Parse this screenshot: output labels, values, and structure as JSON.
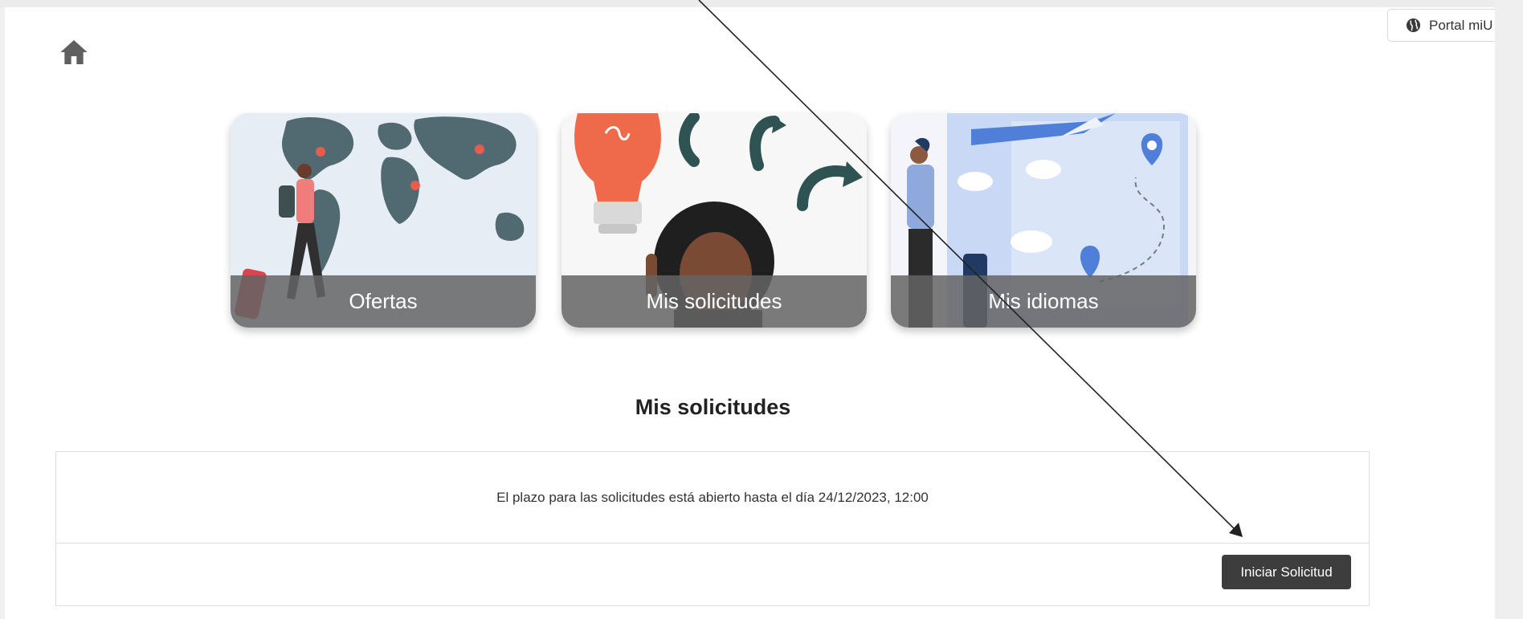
{
  "header": {
    "portal_label": "Portal miU",
    "portal_icon": "globe-icon",
    "home_icon": "home-icon"
  },
  "cards": [
    {
      "label": "Ofertas"
    },
    {
      "label": "Mis solicitudes"
    },
    {
      "label": "Mis idiomas"
    }
  ],
  "section": {
    "title": "Mis solicitudes",
    "notice": "El plazo para las solicitudes está abierto hasta el día 24/12/2023, 12:00",
    "start_button": "Iniciar Solicitud"
  },
  "colors": {
    "button_bg": "#3d3d3d",
    "caption_bg": "#646464",
    "accent_red": "#e85b4f",
    "accent_blue": "#4f7fd9",
    "map_slate": "#516a72"
  }
}
